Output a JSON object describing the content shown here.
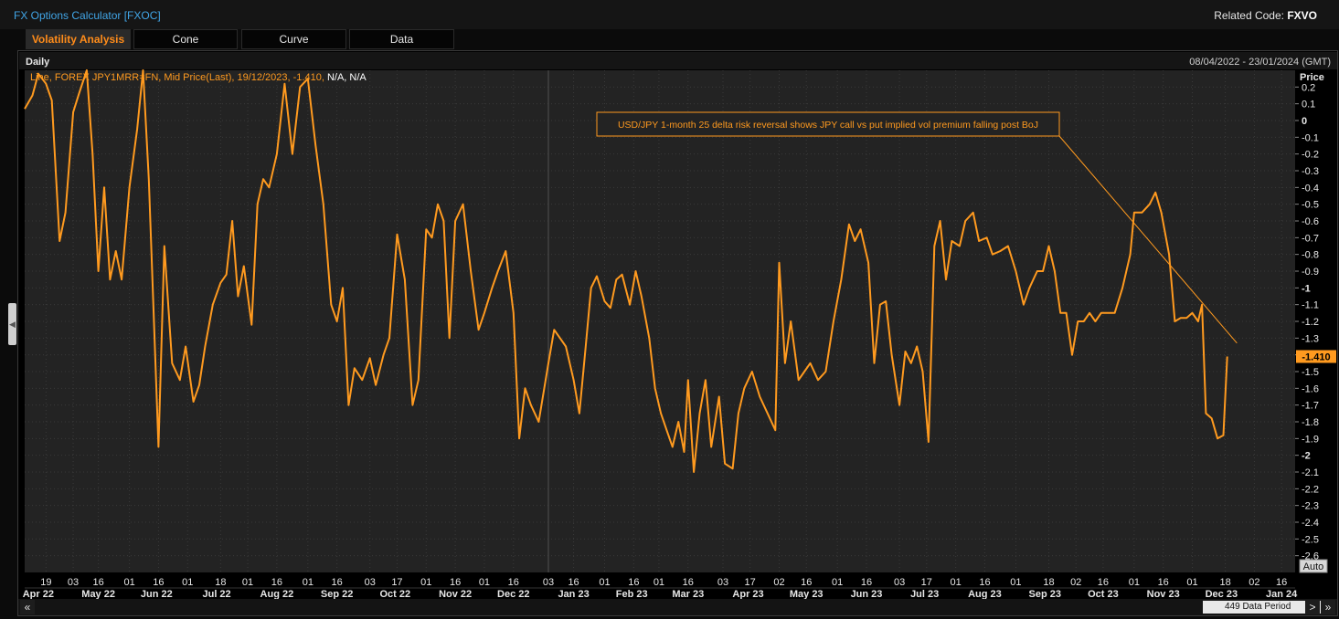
{
  "app": {
    "title": "FX Options Calculator [FXOC]",
    "related_label": "Related Code:",
    "related_code": "FXVO"
  },
  "tabs": [
    "Volatility Analysis",
    "Cone",
    "Curve",
    "Data"
  ],
  "active_tab": 0,
  "chart_header": {
    "frequency": "Daily",
    "date_range": "08/04/2022 - 23/01/2024 (GMT)"
  },
  "legend": {
    "text": "Line, FOREX JPY1MRR=FN, Mid Price(Last),  19/12/2023,  -1.410,",
    "na": "N/A, N/A"
  },
  "annotation": "USD/JPY 1-month 25 delta risk reversal shows JPY call vs put implied vol premium falling post BoJ",
  "footer": {
    "auto_label": "Auto",
    "period_label": "449 Data Period",
    "nav_left": "«",
    "nav_right": "»",
    "scroll_left": "<",
    "scroll_right": ">"
  },
  "colors": {
    "line": "#ff9a1f",
    "grid": "#3a3a3a",
    "background": "#232323",
    "last_badge": "#ff9a1f"
  },
  "chart_data": {
    "type": "line",
    "title": "",
    "ylabel": "Price",
    "ylim": [
      -2.7,
      0.3
    ],
    "y_ticks": [
      0.2,
      0.1,
      0,
      -0.1,
      -0.2,
      -0.3,
      -0.4,
      -0.5,
      -0.6,
      -0.7,
      -0.8,
      -0.9,
      -1,
      -1.1,
      -1.2,
      -1.3,
      -1.4,
      -1.5,
      -1.6,
      -1.7,
      -1.8,
      -1.9,
      -2,
      -2.1,
      -2.2,
      -2.3,
      -2.4,
      -2.5,
      -2.6
    ],
    "y_tick_labels": [
      "0.2",
      "0.1",
      "0",
      "-0.1",
      "-0.2",
      "-0.3",
      "-0.4",
      "-0.5",
      "-0.6",
      "-0.7",
      "-0.8",
      "-0.9",
      "-1",
      "-1.1",
      "-1.2",
      "-1.3",
      "-1.4",
      "-1.5",
      "-1.6",
      "-1.7",
      "-1.8",
      "-1.9",
      "-2",
      "-2.1",
      "-2.2",
      "-2.3",
      "-2.4",
      "-2.5",
      "-2.6"
    ],
    "bold_y_ticks": [
      "0",
      "-1",
      "-2"
    ],
    "x_range": [
      "2022-04-08",
      "2024-01-23"
    ],
    "x_day_ticks": [
      {
        "date": "2022-04-19",
        "label": "19"
      },
      {
        "date": "2022-05-03",
        "label": "03"
      },
      {
        "date": "2022-05-16",
        "label": "16"
      },
      {
        "date": "2022-06-01",
        "label": "01"
      },
      {
        "date": "2022-06-16",
        "label": "16"
      },
      {
        "date": "2022-07-01",
        "label": "01"
      },
      {
        "date": "2022-07-18",
        "label": "18"
      },
      {
        "date": "2022-08-01",
        "label": "01"
      },
      {
        "date": "2022-08-16",
        "label": "16"
      },
      {
        "date": "2022-09-01",
        "label": "01"
      },
      {
        "date": "2022-09-16",
        "label": "16"
      },
      {
        "date": "2022-10-03",
        "label": "03"
      },
      {
        "date": "2022-10-17",
        "label": "17"
      },
      {
        "date": "2022-11-01",
        "label": "01"
      },
      {
        "date": "2022-11-16",
        "label": "16"
      },
      {
        "date": "2022-12-01",
        "label": "01"
      },
      {
        "date": "2022-12-16",
        "label": "16"
      },
      {
        "date": "2023-01-03",
        "label": "03"
      },
      {
        "date": "2023-01-16",
        "label": "16"
      },
      {
        "date": "2023-02-01",
        "label": "01"
      },
      {
        "date": "2023-02-16",
        "label": "16"
      },
      {
        "date": "2023-03-01",
        "label": "01"
      },
      {
        "date": "2023-03-16",
        "label": "16"
      },
      {
        "date": "2023-04-03",
        "label": "03"
      },
      {
        "date": "2023-04-17",
        "label": "17"
      },
      {
        "date": "2023-05-02",
        "label": "02"
      },
      {
        "date": "2023-05-16",
        "label": "16"
      },
      {
        "date": "2023-06-01",
        "label": "01"
      },
      {
        "date": "2023-06-16",
        "label": "16"
      },
      {
        "date": "2023-07-03",
        "label": "03"
      },
      {
        "date": "2023-07-17",
        "label": "17"
      },
      {
        "date": "2023-08-01",
        "label": "01"
      },
      {
        "date": "2023-08-16",
        "label": "16"
      },
      {
        "date": "2023-09-01",
        "label": "01"
      },
      {
        "date": "2023-09-18",
        "label": "18"
      },
      {
        "date": "2023-10-02",
        "label": "02"
      },
      {
        "date": "2023-10-16",
        "label": "16"
      },
      {
        "date": "2023-11-01",
        "label": "01"
      },
      {
        "date": "2023-11-16",
        "label": "16"
      },
      {
        "date": "2023-12-01",
        "label": "01"
      },
      {
        "date": "2023-12-18",
        "label": "18"
      },
      {
        "date": "2024-01-02",
        "label": "02"
      },
      {
        "date": "2024-01-16",
        "label": "16"
      }
    ],
    "x_month_labels": [
      {
        "date": "2022-04-15",
        "label": "Apr 22"
      },
      {
        "date": "2022-05-16",
        "label": "May 22"
      },
      {
        "date": "2022-06-15",
        "label": "Jun 22"
      },
      {
        "date": "2022-07-16",
        "label": "Jul 22"
      },
      {
        "date": "2022-08-16",
        "label": "Aug 22"
      },
      {
        "date": "2022-09-16",
        "label": "Sep 22"
      },
      {
        "date": "2022-10-16",
        "label": "Oct 22"
      },
      {
        "date": "2022-11-16",
        "label": "Nov 22"
      },
      {
        "date": "2022-12-16",
        "label": "Dec 22"
      },
      {
        "date": "2023-01-16",
        "label": "Jan 23"
      },
      {
        "date": "2023-02-15",
        "label": "Feb 23"
      },
      {
        "date": "2023-03-16",
        "label": "Mar 23"
      },
      {
        "date": "2023-04-16",
        "label": "Apr 23"
      },
      {
        "date": "2023-05-16",
        "label": "May 23"
      },
      {
        "date": "2023-06-16",
        "label": "Jun 23"
      },
      {
        "date": "2023-07-16",
        "label": "Jul 23"
      },
      {
        "date": "2023-08-16",
        "label": "Aug 23"
      },
      {
        "date": "2023-09-16",
        "label": "Sep 23"
      },
      {
        "date": "2023-10-16",
        "label": "Oct 23"
      },
      {
        "date": "2023-11-16",
        "label": "Nov 23"
      },
      {
        "date": "2023-12-16",
        "label": "Dec 23"
      },
      {
        "date": "2024-01-16",
        "label": "Jan 24"
      }
    ],
    "series": [
      {
        "points": [
          [
            "2022-04-08",
            0.07
          ],
          [
            "2022-04-12",
            0.15
          ],
          [
            "2022-04-15",
            0.28
          ],
          [
            "2022-04-19",
            0.22
          ],
          [
            "2022-04-22",
            0.12
          ],
          [
            "2022-04-26",
            -0.72
          ],
          [
            "2022-04-29",
            -0.55
          ],
          [
            "2022-05-03",
            0.05
          ],
          [
            "2022-05-06",
            0.16
          ],
          [
            "2022-05-10",
            0.3
          ],
          [
            "2022-05-13",
            -0.2
          ],
          [
            "2022-05-16",
            -0.9
          ],
          [
            "2022-05-19",
            -0.4
          ],
          [
            "2022-05-22",
            -0.95
          ],
          [
            "2022-05-25",
            -0.78
          ],
          [
            "2022-05-28",
            -0.95
          ],
          [
            "2022-06-01",
            -0.4
          ],
          [
            "2022-06-05",
            -0.05
          ],
          [
            "2022-06-08",
            0.3
          ],
          [
            "2022-06-11",
            -0.35
          ],
          [
            "2022-06-16",
            -1.95
          ],
          [
            "2022-06-19",
            -0.75
          ],
          [
            "2022-06-23",
            -1.45
          ],
          [
            "2022-06-27",
            -1.55
          ],
          [
            "2022-06-30",
            -1.35
          ],
          [
            "2022-07-04",
            -1.68
          ],
          [
            "2022-07-07",
            -1.58
          ],
          [
            "2022-07-10",
            -1.35
          ],
          [
            "2022-07-14",
            -1.1
          ],
          [
            "2022-07-18",
            -0.97
          ],
          [
            "2022-07-21",
            -0.92
          ],
          [
            "2022-07-24",
            -0.6
          ],
          [
            "2022-07-27",
            -1.05
          ],
          [
            "2022-07-30",
            -0.87
          ],
          [
            "2022-08-03",
            -1.22
          ],
          [
            "2022-08-06",
            -0.5
          ],
          [
            "2022-08-09",
            -0.35
          ],
          [
            "2022-08-12",
            -0.4
          ],
          [
            "2022-08-16",
            -0.2
          ],
          [
            "2022-08-20",
            0.22
          ],
          [
            "2022-08-24",
            -0.2
          ],
          [
            "2022-08-28",
            0.2
          ],
          [
            "2022-09-01",
            0.25
          ],
          [
            "2022-09-05",
            -0.15
          ],
          [
            "2022-09-09",
            -0.5
          ],
          [
            "2022-09-13",
            -1.1
          ],
          [
            "2022-09-16",
            -1.2
          ],
          [
            "2022-09-19",
            -1.0
          ],
          [
            "2022-09-22",
            -1.7
          ],
          [
            "2022-09-25",
            -1.48
          ],
          [
            "2022-09-29",
            -1.55
          ],
          [
            "2022-10-03",
            -1.42
          ],
          [
            "2022-10-06",
            -1.58
          ],
          [
            "2022-10-10",
            -1.4
          ],
          [
            "2022-10-13",
            -1.3
          ],
          [
            "2022-10-17",
            -0.68
          ],
          [
            "2022-10-21",
            -0.95
          ],
          [
            "2022-10-25",
            -1.7
          ],
          [
            "2022-10-28",
            -1.55
          ],
          [
            "2022-11-01",
            -0.65
          ],
          [
            "2022-11-04",
            -0.7
          ],
          [
            "2022-11-07",
            -0.5
          ],
          [
            "2022-11-10",
            -0.6
          ],
          [
            "2022-11-13",
            -1.3
          ],
          [
            "2022-11-16",
            -0.6
          ],
          [
            "2022-11-20",
            -0.5
          ],
          [
            "2022-11-24",
            -0.9
          ],
          [
            "2022-11-28",
            -1.25
          ],
          [
            "2022-12-01",
            -1.15
          ],
          [
            "2022-12-05",
            -1.0
          ],
          [
            "2022-12-08",
            -0.9
          ],
          [
            "2022-12-12",
            -0.78
          ],
          [
            "2022-12-16",
            -1.15
          ],
          [
            "2022-12-19",
            -1.9
          ],
          [
            "2022-12-22",
            -1.6
          ],
          [
            "2022-12-25",
            -1.7
          ],
          [
            "2022-12-29",
            -1.8
          ],
          [
            "2023-01-03",
            -1.45
          ],
          [
            "2023-01-06",
            -1.25
          ],
          [
            "2023-01-09",
            -1.3
          ],
          [
            "2023-01-12",
            -1.35
          ],
          [
            "2023-01-16",
            -1.55
          ],
          [
            "2023-01-19",
            -1.75
          ],
          [
            "2023-01-22",
            -1.38
          ],
          [
            "2023-01-25",
            -1.0
          ],
          [
            "2023-01-28",
            -0.93
          ],
          [
            "2023-02-01",
            -1.08
          ],
          [
            "2023-02-04",
            -1.12
          ],
          [
            "2023-02-07",
            -0.95
          ],
          [
            "2023-02-10",
            -0.92
          ],
          [
            "2023-02-14",
            -1.1
          ],
          [
            "2023-02-17",
            -0.9
          ],
          [
            "2023-02-20",
            -1.05
          ],
          [
            "2023-02-24",
            -1.3
          ],
          [
            "2023-02-27",
            -1.6
          ],
          [
            "2023-03-02",
            -1.75
          ],
          [
            "2023-03-05",
            -1.85
          ],
          [
            "2023-03-08",
            -1.95
          ],
          [
            "2023-03-11",
            -1.8
          ],
          [
            "2023-03-14",
            -1.98
          ],
          [
            "2023-03-16",
            -1.55
          ],
          [
            "2023-03-19",
            -2.1
          ],
          [
            "2023-03-22",
            -1.75
          ],
          [
            "2023-03-25",
            -1.55
          ],
          [
            "2023-03-28",
            -1.95
          ],
          [
            "2023-04-01",
            -1.65
          ],
          [
            "2023-04-04",
            -2.05
          ],
          [
            "2023-04-08",
            -2.08
          ],
          [
            "2023-04-11",
            -1.75
          ],
          [
            "2023-04-14",
            -1.6
          ],
          [
            "2023-04-18",
            -1.5
          ],
          [
            "2023-04-22",
            -1.65
          ],
          [
            "2023-04-26",
            -1.75
          ],
          [
            "2023-04-30",
            -1.85
          ],
          [
            "2023-05-02",
            -0.85
          ],
          [
            "2023-05-05",
            -1.45
          ],
          [
            "2023-05-08",
            -1.2
          ],
          [
            "2023-05-12",
            -1.55
          ],
          [
            "2023-05-15",
            -1.5
          ],
          [
            "2023-05-18",
            -1.45
          ],
          [
            "2023-05-22",
            -1.55
          ],
          [
            "2023-05-26",
            -1.5
          ],
          [
            "2023-05-30",
            -1.2
          ],
          [
            "2023-06-03",
            -0.95
          ],
          [
            "2023-06-07",
            -0.62
          ],
          [
            "2023-06-10",
            -0.72
          ],
          [
            "2023-06-13",
            -0.65
          ],
          [
            "2023-06-17",
            -0.85
          ],
          [
            "2023-06-20",
            -1.45
          ],
          [
            "2023-06-23",
            -1.1
          ],
          [
            "2023-06-26",
            -1.08
          ],
          [
            "2023-06-29",
            -1.4
          ],
          [
            "2023-07-03",
            -1.7
          ],
          [
            "2023-07-06",
            -1.38
          ],
          [
            "2023-07-09",
            -1.45
          ],
          [
            "2023-07-12",
            -1.35
          ],
          [
            "2023-07-15",
            -1.5
          ],
          [
            "2023-07-18",
            -1.92
          ],
          [
            "2023-07-21",
            -0.75
          ],
          [
            "2023-07-24",
            -0.6
          ],
          [
            "2023-07-27",
            -0.95
          ],
          [
            "2023-07-30",
            -0.72
          ],
          [
            "2023-08-03",
            -0.75
          ],
          [
            "2023-08-06",
            -0.6
          ],
          [
            "2023-08-10",
            -0.55
          ],
          [
            "2023-08-13",
            -0.72
          ],
          [
            "2023-08-17",
            -0.7
          ],
          [
            "2023-08-20",
            -0.8
          ],
          [
            "2023-08-24",
            -0.78
          ],
          [
            "2023-08-28",
            -0.75
          ],
          [
            "2023-09-01",
            -0.9
          ],
          [
            "2023-09-05",
            -1.1
          ],
          [
            "2023-09-08",
            -1.0
          ],
          [
            "2023-09-12",
            -0.9
          ],
          [
            "2023-09-15",
            -0.9
          ],
          [
            "2023-09-18",
            -0.75
          ],
          [
            "2023-09-21",
            -0.9
          ],
          [
            "2023-09-24",
            -1.15
          ],
          [
            "2023-09-27",
            -1.15
          ],
          [
            "2023-09-30",
            -1.4
          ],
          [
            "2023-10-03",
            -1.2
          ],
          [
            "2023-10-06",
            -1.2
          ],
          [
            "2023-10-09",
            -1.15
          ],
          [
            "2023-10-12",
            -1.2
          ],
          [
            "2023-10-15",
            -1.15
          ],
          [
            "2023-10-18",
            -1.15
          ],
          [
            "2023-10-22",
            -1.15
          ],
          [
            "2023-10-26",
            -1.0
          ],
          [
            "2023-10-30",
            -0.8
          ],
          [
            "2023-11-01",
            -0.55
          ],
          [
            "2023-11-05",
            -0.55
          ],
          [
            "2023-11-09",
            -0.5
          ],
          [
            "2023-11-12",
            -0.43
          ],
          [
            "2023-11-15",
            -0.55
          ],
          [
            "2023-11-19",
            -0.8
          ],
          [
            "2023-11-22",
            -1.2
          ],
          [
            "2023-11-25",
            -1.18
          ],
          [
            "2023-11-28",
            -1.18
          ],
          [
            "2023-12-01",
            -1.15
          ],
          [
            "2023-12-04",
            -1.2
          ],
          [
            "2023-12-06",
            -1.1
          ],
          [
            "2023-12-08",
            -1.75
          ],
          [
            "2023-12-11",
            -1.78
          ],
          [
            "2023-12-14",
            -1.9
          ],
          [
            "2023-12-17",
            -1.88
          ],
          [
            "2023-12-19",
            -1.41
          ]
        ]
      }
    ],
    "last_value": -1.41,
    "last_value_label": "-1.410",
    "last_date": "2023-12-19"
  }
}
